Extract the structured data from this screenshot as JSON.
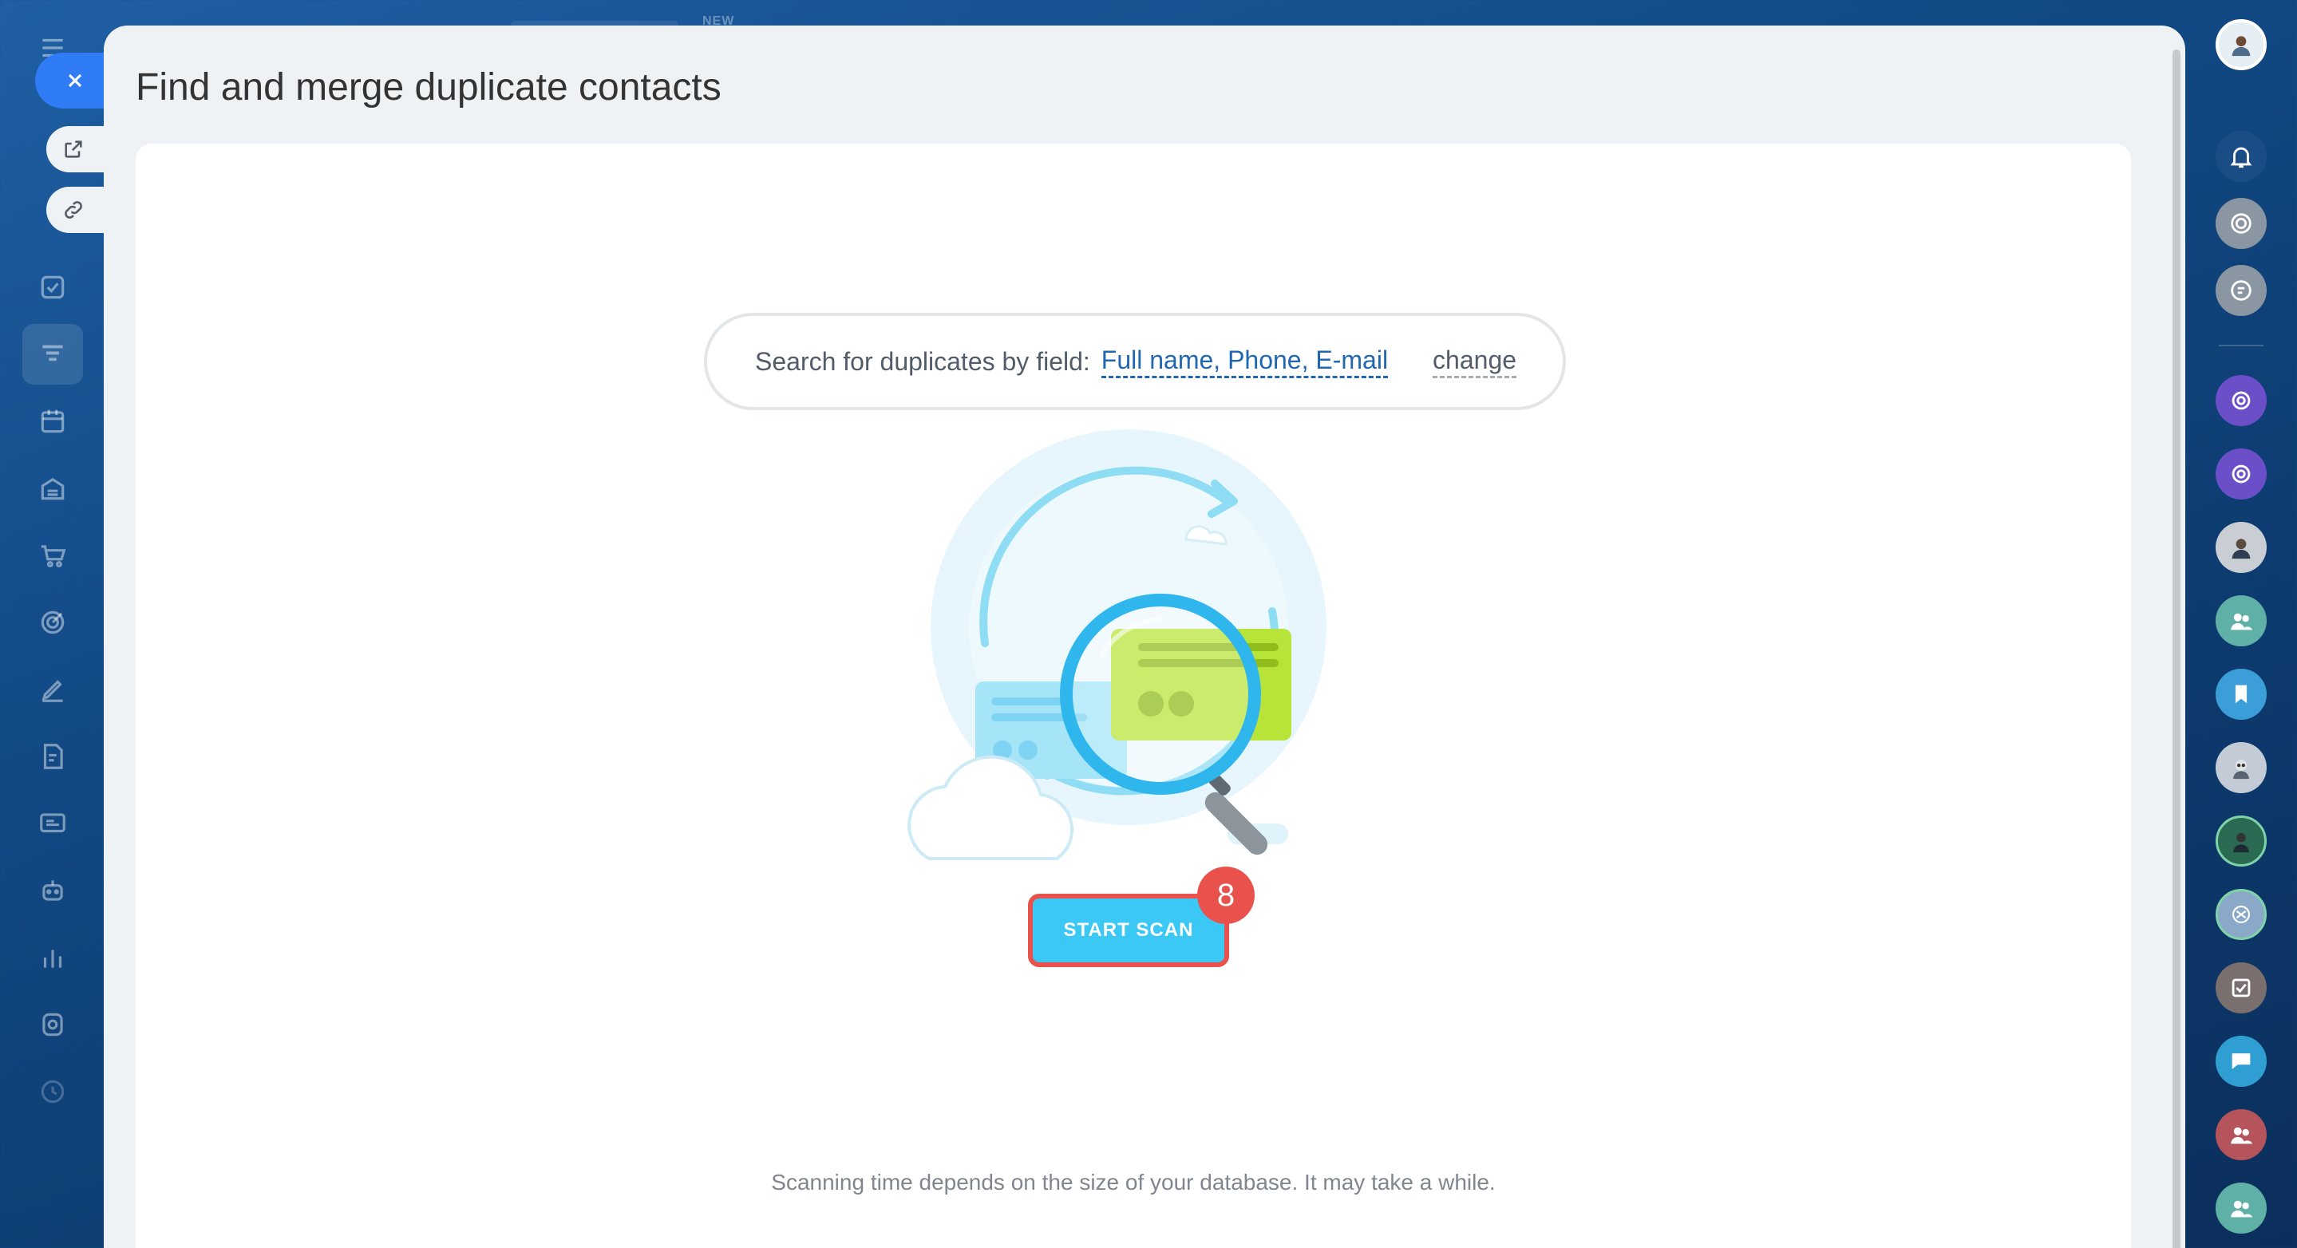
{
  "slider": {
    "title": "Find and merge duplicate contacts"
  },
  "search": {
    "label": "Search for duplicates by field:",
    "fields_value": "Full name, Phone, E-mail",
    "change_label": "change"
  },
  "action": {
    "start_scan_label": "START SCAN",
    "step_badge": "8"
  },
  "hint": "Scanning time depends on the size of your database. It may take a while.",
  "top_bar": {
    "new_label": "NEW"
  },
  "colors": {
    "accent": "#3bc8f5",
    "highlight": "#e9524c",
    "link": "#2067b0"
  },
  "left_nav_icons": [
    "menu-icon",
    "tasks-icon",
    "crm-icon",
    "calendar-icon",
    "inventory-icon",
    "shop-icon",
    "sites-icon",
    "signature-icon",
    "documents-icon",
    "contact-center-icon",
    "automation-icon",
    "analytics-icon",
    "marketplace-icon",
    "settings-icon"
  ],
  "right_bar_icons": [
    "avatar",
    "notifications-icon",
    "chat-icon",
    "feed-icon",
    "channel-icon",
    "channel-icon",
    "user-avatar",
    "group-icon",
    "bookmark-icon",
    "user-avatar",
    "user-avatar",
    "user-avatar",
    "tasks-icon",
    "chat-icon",
    "group-icon",
    "group-icon"
  ]
}
